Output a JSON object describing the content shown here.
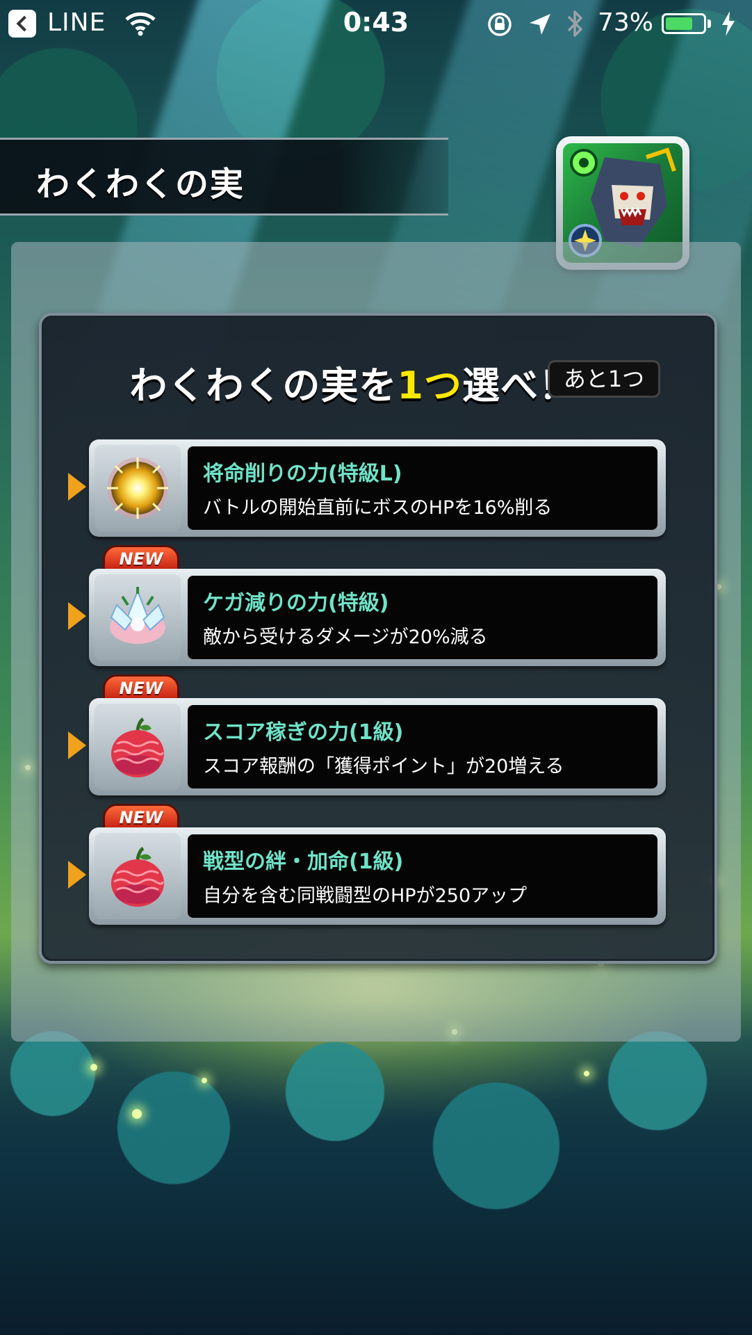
{
  "status_bar": {
    "app": "LINE",
    "time": "0:43",
    "battery_percent": "73%",
    "battery_level": 0.73
  },
  "header": {
    "title": "わくわくの実"
  },
  "prompt": {
    "pre": "わくわくの実を",
    "highlight": "1つ",
    "post": "選べ！",
    "remaining": "あと1つ"
  },
  "options": [
    {
      "name": "将命削りの力(特級L)",
      "description": "バトルの開始直前にボスのHPを16%削る",
      "is_new": false,
      "icon": "sun-orb-icon"
    },
    {
      "name": "ケガ減りの力(特級)",
      "description": "敵から受けるダメージが20%減る",
      "is_new": true,
      "icon": "crystal-lotus-icon"
    },
    {
      "name": "スコア稼ぎの力(1級)",
      "description": "スコア報酬の「獲得ポイント」が20増える",
      "is_new": true,
      "icon": "red-fruit-icon"
    },
    {
      "name": "戦型の絆・加命(1級)",
      "description": "自分を含む同戦闘型のHPが250アップ",
      "is_new": true,
      "icon": "red-fruit-icon"
    }
  ],
  "new_label": "NEW",
  "colors": {
    "highlight": "#ffe800",
    "option_name": "#6fe3c8",
    "arrow": "#f0a21c",
    "battery": "#4cd964"
  }
}
